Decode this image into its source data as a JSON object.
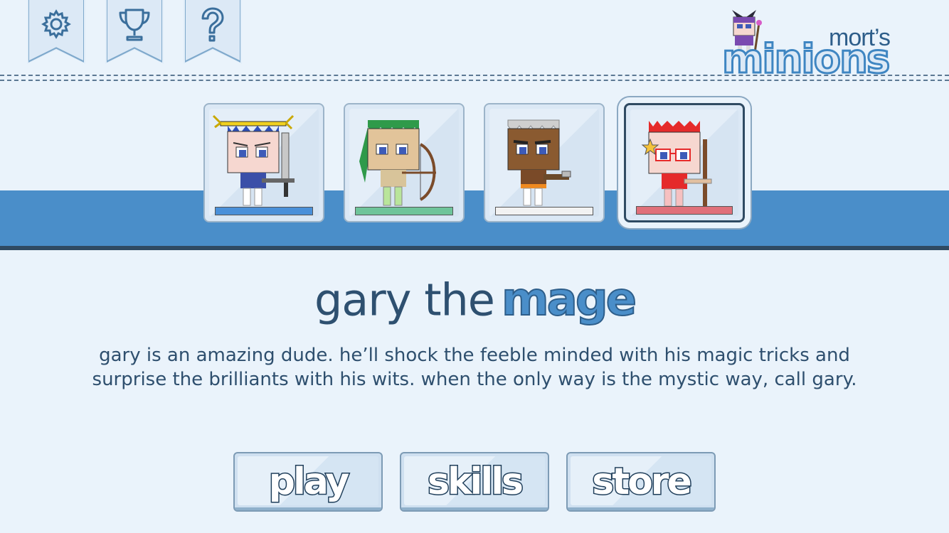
{
  "top_menu": {
    "settings_icon": "gear-icon",
    "achievements_icon": "trophy-icon",
    "help_icon": "question-icon"
  },
  "logo": {
    "line1": "mort’s",
    "line2": "minions"
  },
  "characters": [
    {
      "id": "warrior",
      "hair_color": "#2e4fb8",
      "bar_color": "#4a90d9",
      "selected": false
    },
    {
      "id": "archer",
      "hair_color": "#2f9a4a",
      "bar_color": "#6ec49a",
      "selected": false
    },
    {
      "id": "gunner",
      "hair_color": "#cfcfcf",
      "bar_color": "#f2f2f2",
      "selected": false
    },
    {
      "id": "mage",
      "hair_color": "#e52a2a",
      "bar_color": "#e0707a",
      "selected": true
    }
  ],
  "selected_character": {
    "name_prefix": "gary the",
    "class_name": "mage",
    "description": "gary is an amazing dude. he’ll shock the feeble minded with his magic tricks and surprise the brilliants with his wits. when the only way is the mystic way, call gary."
  },
  "buttons": {
    "play": "play",
    "skills": "skills",
    "store": "store"
  },
  "colors": {
    "band": "#4a8ec9",
    "background": "#eaf3fb",
    "title_text": "#2e5070"
  }
}
